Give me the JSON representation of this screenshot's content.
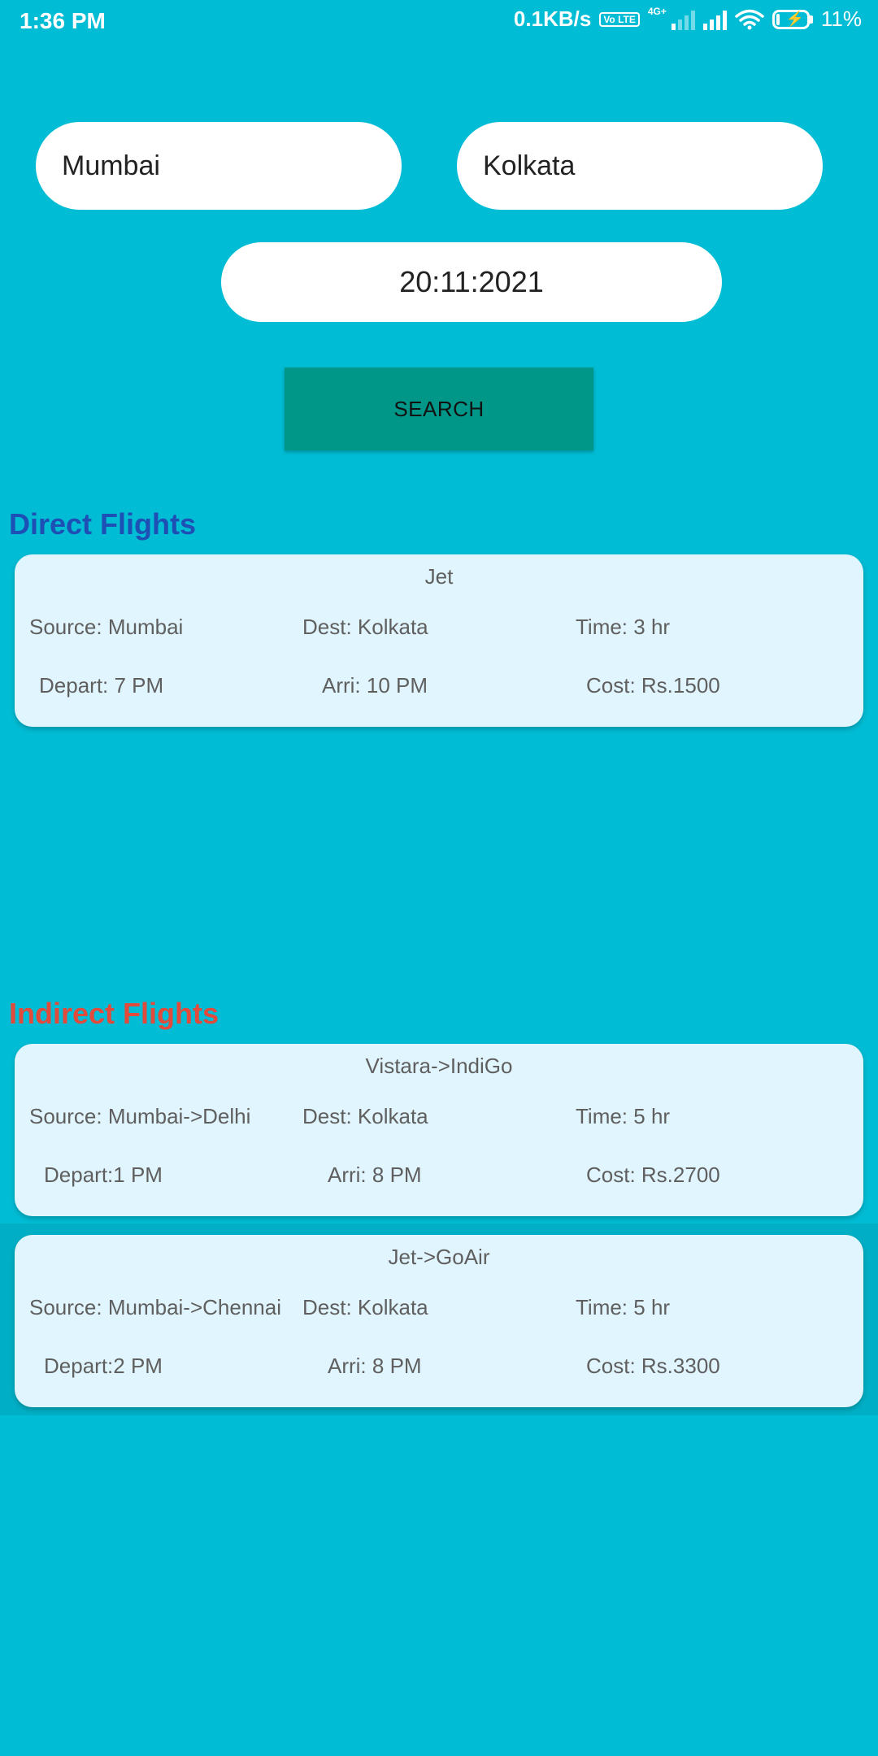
{
  "status_bar": {
    "time": "1:36 PM",
    "net_speed": "0.1KB/s",
    "volte_badge": "Vo LTE",
    "network_type": "4G+",
    "battery_percent": "11%",
    "battery_level": 0.11,
    "icons": [
      "volte-icon",
      "signal-icon",
      "signal-icon",
      "wifi-icon",
      "battery-charging-icon"
    ]
  },
  "search_form": {
    "source_value": "Mumbai",
    "destination_value": "Kolkata",
    "date_value": "20:11:2021",
    "search_label": "SEARCH"
  },
  "direct": {
    "title": "Direct Flights",
    "flights": [
      {
        "airline": "Jet",
        "source": "Source: Mumbai",
        "dest": "Dest: Kolkata",
        "time": "Time: 3 hr",
        "depart": "Depart: 7 PM",
        "arrive": "Arri: 10 PM",
        "cost": "Cost: Rs.1500"
      }
    ]
  },
  "indirect": {
    "title": "Indirect Flights",
    "flights": [
      {
        "airline": "Vistara->IndiGo",
        "source": "Source: Mumbai->Delhi",
        "dest": "Dest: Kolkata",
        "time": "Time: 5 hr",
        "depart": "Depart:1 PM",
        "arrive": "Arri: 8 PM",
        "cost": "Cost: Rs.2700"
      },
      {
        "airline": "Jet->GoAir",
        "source": "Source: Mumbai->Chennai",
        "dest": "Dest: Kolkata",
        "time": "Time: 5 hr",
        "depart": "Depart:2 PM",
        "arrive": "Arri: 8 PM",
        "cost": "Cost: Rs.3300"
      }
    ]
  },
  "colors": {
    "background": "#00BCD4",
    "search_button": "#009688",
    "card": "#E1F5FE",
    "direct_title": "#1E4FB5",
    "indirect_title": "#E24A3B"
  }
}
